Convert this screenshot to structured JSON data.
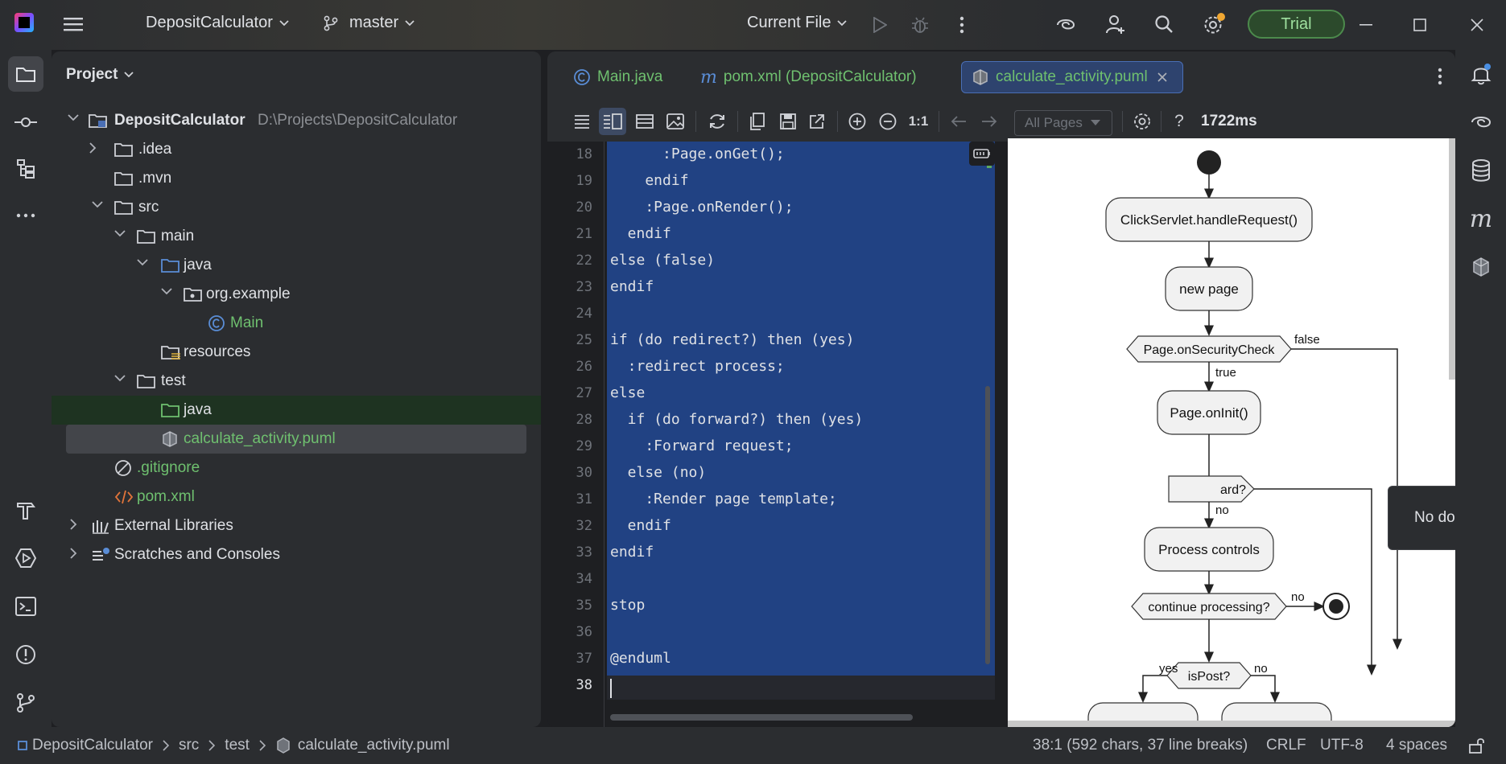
{
  "titlebar": {
    "project_name": "DepositCalculator",
    "branch": "master",
    "run_config": "Current File",
    "trial_label": "Trial"
  },
  "project_panel": {
    "title": "Project",
    "root_name": "DepositCalculator",
    "root_path": "D:\\Projects\\DepositCalculator",
    "items": [
      {
        "label": ".idea"
      },
      {
        "label": ".mvn"
      },
      {
        "label": "src"
      },
      {
        "label": "main"
      },
      {
        "label": "java"
      },
      {
        "label": "org.example"
      },
      {
        "label": "Main"
      },
      {
        "label": "resources"
      },
      {
        "label": "test"
      },
      {
        "label": "java"
      },
      {
        "label": "calculate_activity.puml"
      },
      {
        "label": ".gitignore"
      },
      {
        "label": "pom.xml"
      },
      {
        "label": "External Libraries"
      },
      {
        "label": "Scratches and Consoles"
      }
    ]
  },
  "editor": {
    "tabs": [
      {
        "label": "Main.java"
      },
      {
        "label": "pom.xml (DepositCalculator)"
      },
      {
        "label": "calculate_activity.puml"
      }
    ],
    "toolbar": {
      "zoom_one": "1:1",
      "pages_select": "All Pages",
      "help": "?",
      "timing": "1722ms"
    },
    "line_numbers": [
      "18",
      "19",
      "20",
      "21",
      "22",
      "23",
      "24",
      "25",
      "26",
      "27",
      "28",
      "29",
      "30",
      "31",
      "32",
      "33",
      "34",
      "35",
      "36",
      "37",
      "38"
    ],
    "code_lines": [
      "      :Page.onGet();",
      "    endif",
      "    :Page.onRender();",
      "  endif",
      "else (false)",
      "endif",
      "",
      "if (do redirect?) then (yes)",
      "  :redirect process;",
      "else",
      "  if (do forward?) then (yes)",
      "    :Forward request;",
      "  else (no)",
      "    :Render page template;",
      "  endif",
      "endif",
      "",
      "stop",
      "",
      "@enduml",
      ""
    ],
    "popup_text": "No documentation found."
  },
  "diagram": {
    "nodes": {
      "handle": "ClickServlet.handleRequest()",
      "newpage": "new page",
      "security": "Page.onSecurityCheck",
      "oninit": "Page.onInit()",
      "forward_partial": "ard?",
      "process": "Process controls",
      "continue": "continue processing?",
      "ispost": "isPost?"
    },
    "labels": {
      "false": "false",
      "true": "true",
      "no1": "no",
      "no2": "no",
      "yes": "yes",
      "no3": "no"
    }
  },
  "statusbar": {
    "crumbs": [
      "DepositCalculator",
      "src",
      "test",
      "calculate_activity.puml"
    ],
    "position": "38:1 (592 chars, 37 line breaks)",
    "line_sep": "CRLF",
    "encoding": "UTF-8",
    "indent": "4 spaces"
  },
  "colors": {
    "accent": "#4a6fb5",
    "selection": "#214283",
    "green_text": "#6fc06f",
    "trial_green": "#4c8a4c"
  }
}
